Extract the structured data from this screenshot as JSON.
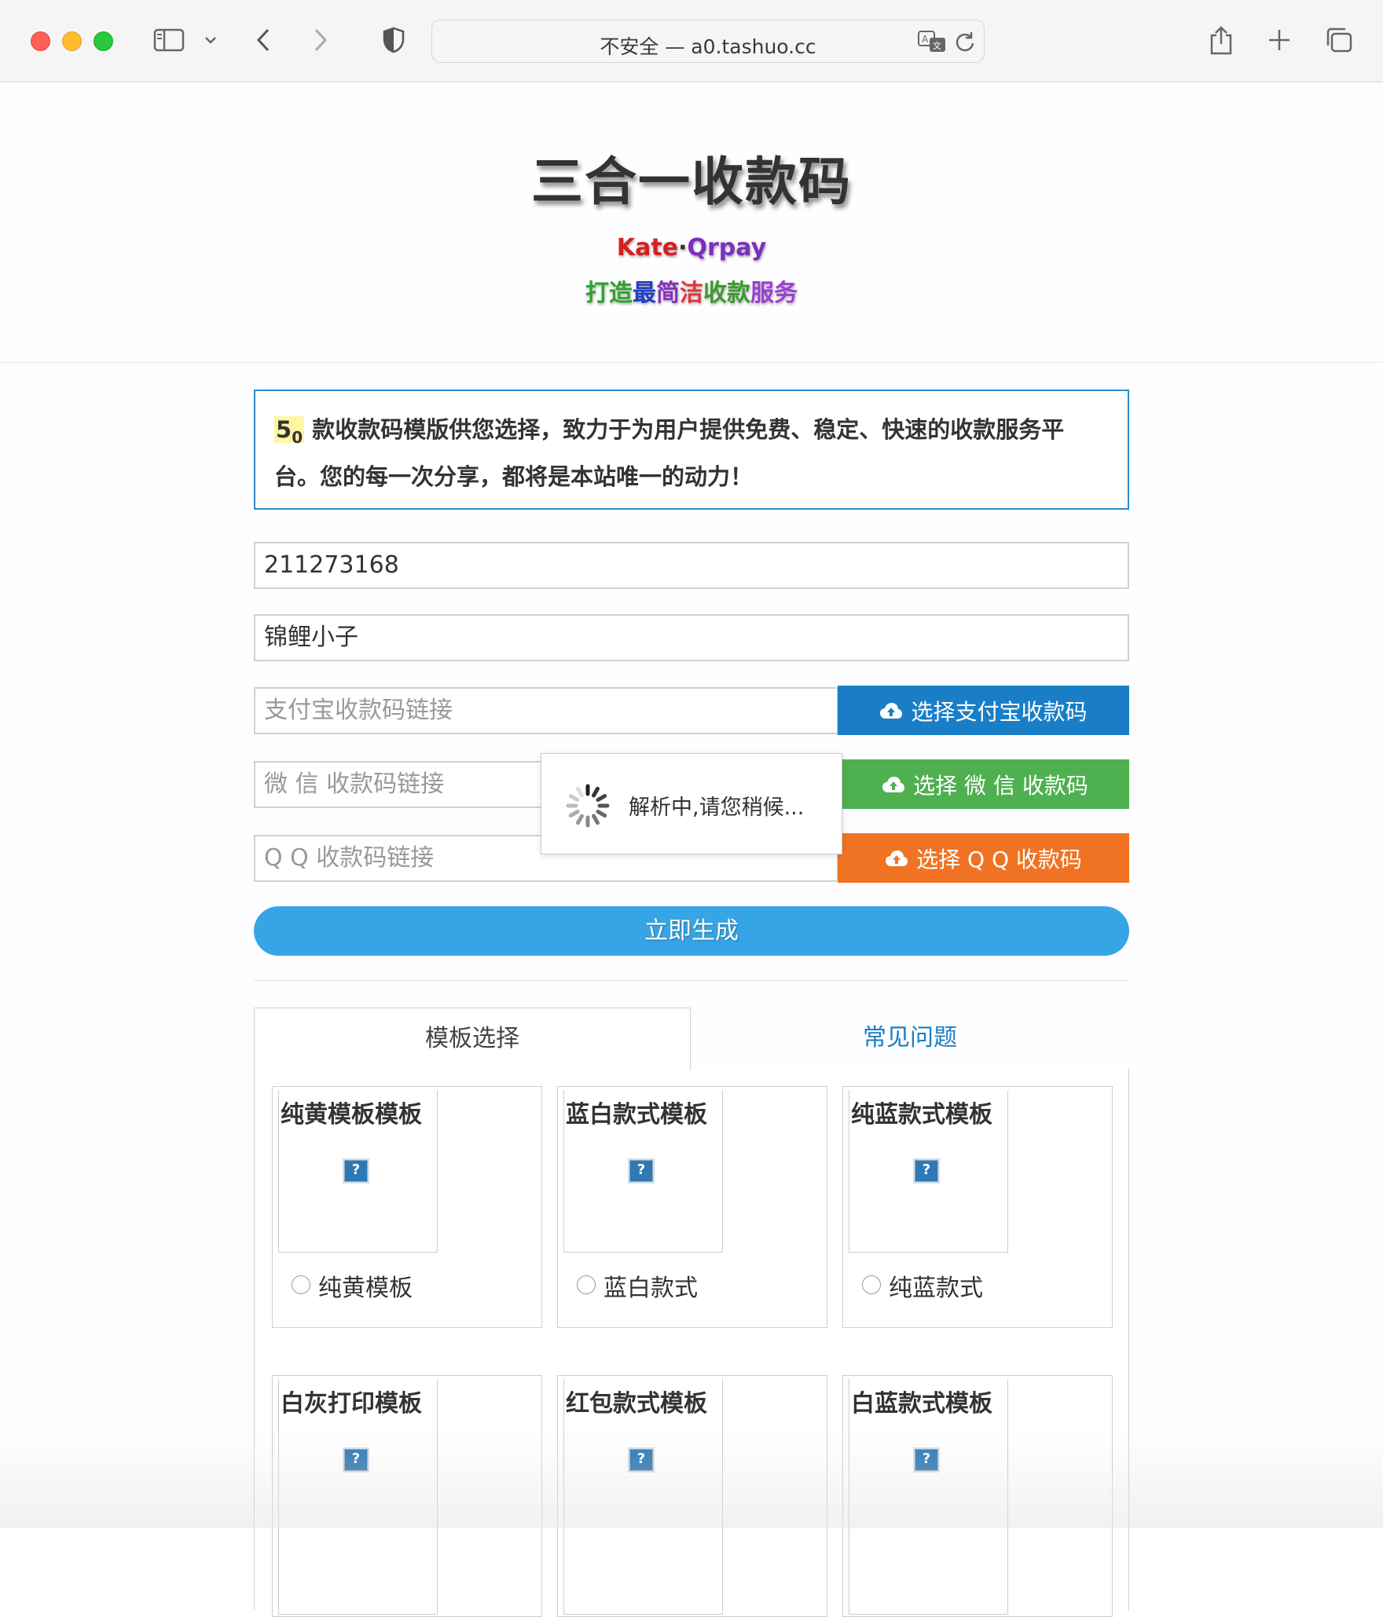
{
  "browser": {
    "url": "不安全 — a0.tashuo.cc"
  },
  "hero": {
    "title": "三合一收款码",
    "brand": [
      {
        "text": "Kate",
        "color": "#d81e1e"
      },
      {
        "text": "·",
        "color": "#333333"
      },
      {
        "text": "Qrpay",
        "color": "#7b2fbe"
      }
    ],
    "slogan": [
      {
        "text": "打造",
        "color": "#2fa330"
      },
      {
        "text": "最",
        "color": "#1f3fbf"
      },
      {
        "text": "简",
        "color": "#8a2fbf"
      },
      {
        "text": "洁",
        "color": "#e0353a"
      },
      {
        "text": "收款",
        "color": "#3a9a2e"
      },
      {
        "text": "服务",
        "color": "#9a3fd0"
      }
    ]
  },
  "notice": {
    "count": "5",
    "count_sub": "0",
    "text": "款收款码模版供您选择，致力于为用户提供免费、稳定、快速的收款服务平台。您的每一次分享，都将是本站唯一的动力！"
  },
  "form": {
    "qq_number": "211273168",
    "nickname": "锦鲤小子",
    "alipay_placeholder": "支付宝收款码链接",
    "wechat_placeholder": "微 信 收款码链接",
    "qq_placeholder": "Q Q 收款码链接",
    "alipay_button": "选择支付宝收款码",
    "wechat_button": "选择 微 信 收款码",
    "qq_button": "选择 Q Q 收款码",
    "generate_button": "立即生成"
  },
  "loader": {
    "message": "解析中,请您稍候..."
  },
  "tabs": {
    "templates": "模板选择",
    "faq": "常见问题"
  },
  "templates": [
    {
      "title": "纯黄模板模板",
      "option": "纯黄模板"
    },
    {
      "title": "蓝白款式模板",
      "option": "蓝白款式"
    },
    {
      "title": "纯蓝款式模板",
      "option": "纯蓝款式"
    },
    {
      "title": "白灰打印模板",
      "option": ""
    },
    {
      "title": "红包款式模板",
      "option": ""
    },
    {
      "title": "白蓝款式模板",
      "option": ""
    }
  ],
  "icons": {
    "upload": "cloud-upload-icon",
    "broken_image": "broken-image-icon",
    "spinner": "spinner-icon"
  },
  "colors": {
    "alipay": "#1a7ec7",
    "wechat": "#4fb050",
    "qq": "#f07323",
    "generate": "#36a5e6",
    "notice_border": "#2e8bd1"
  }
}
